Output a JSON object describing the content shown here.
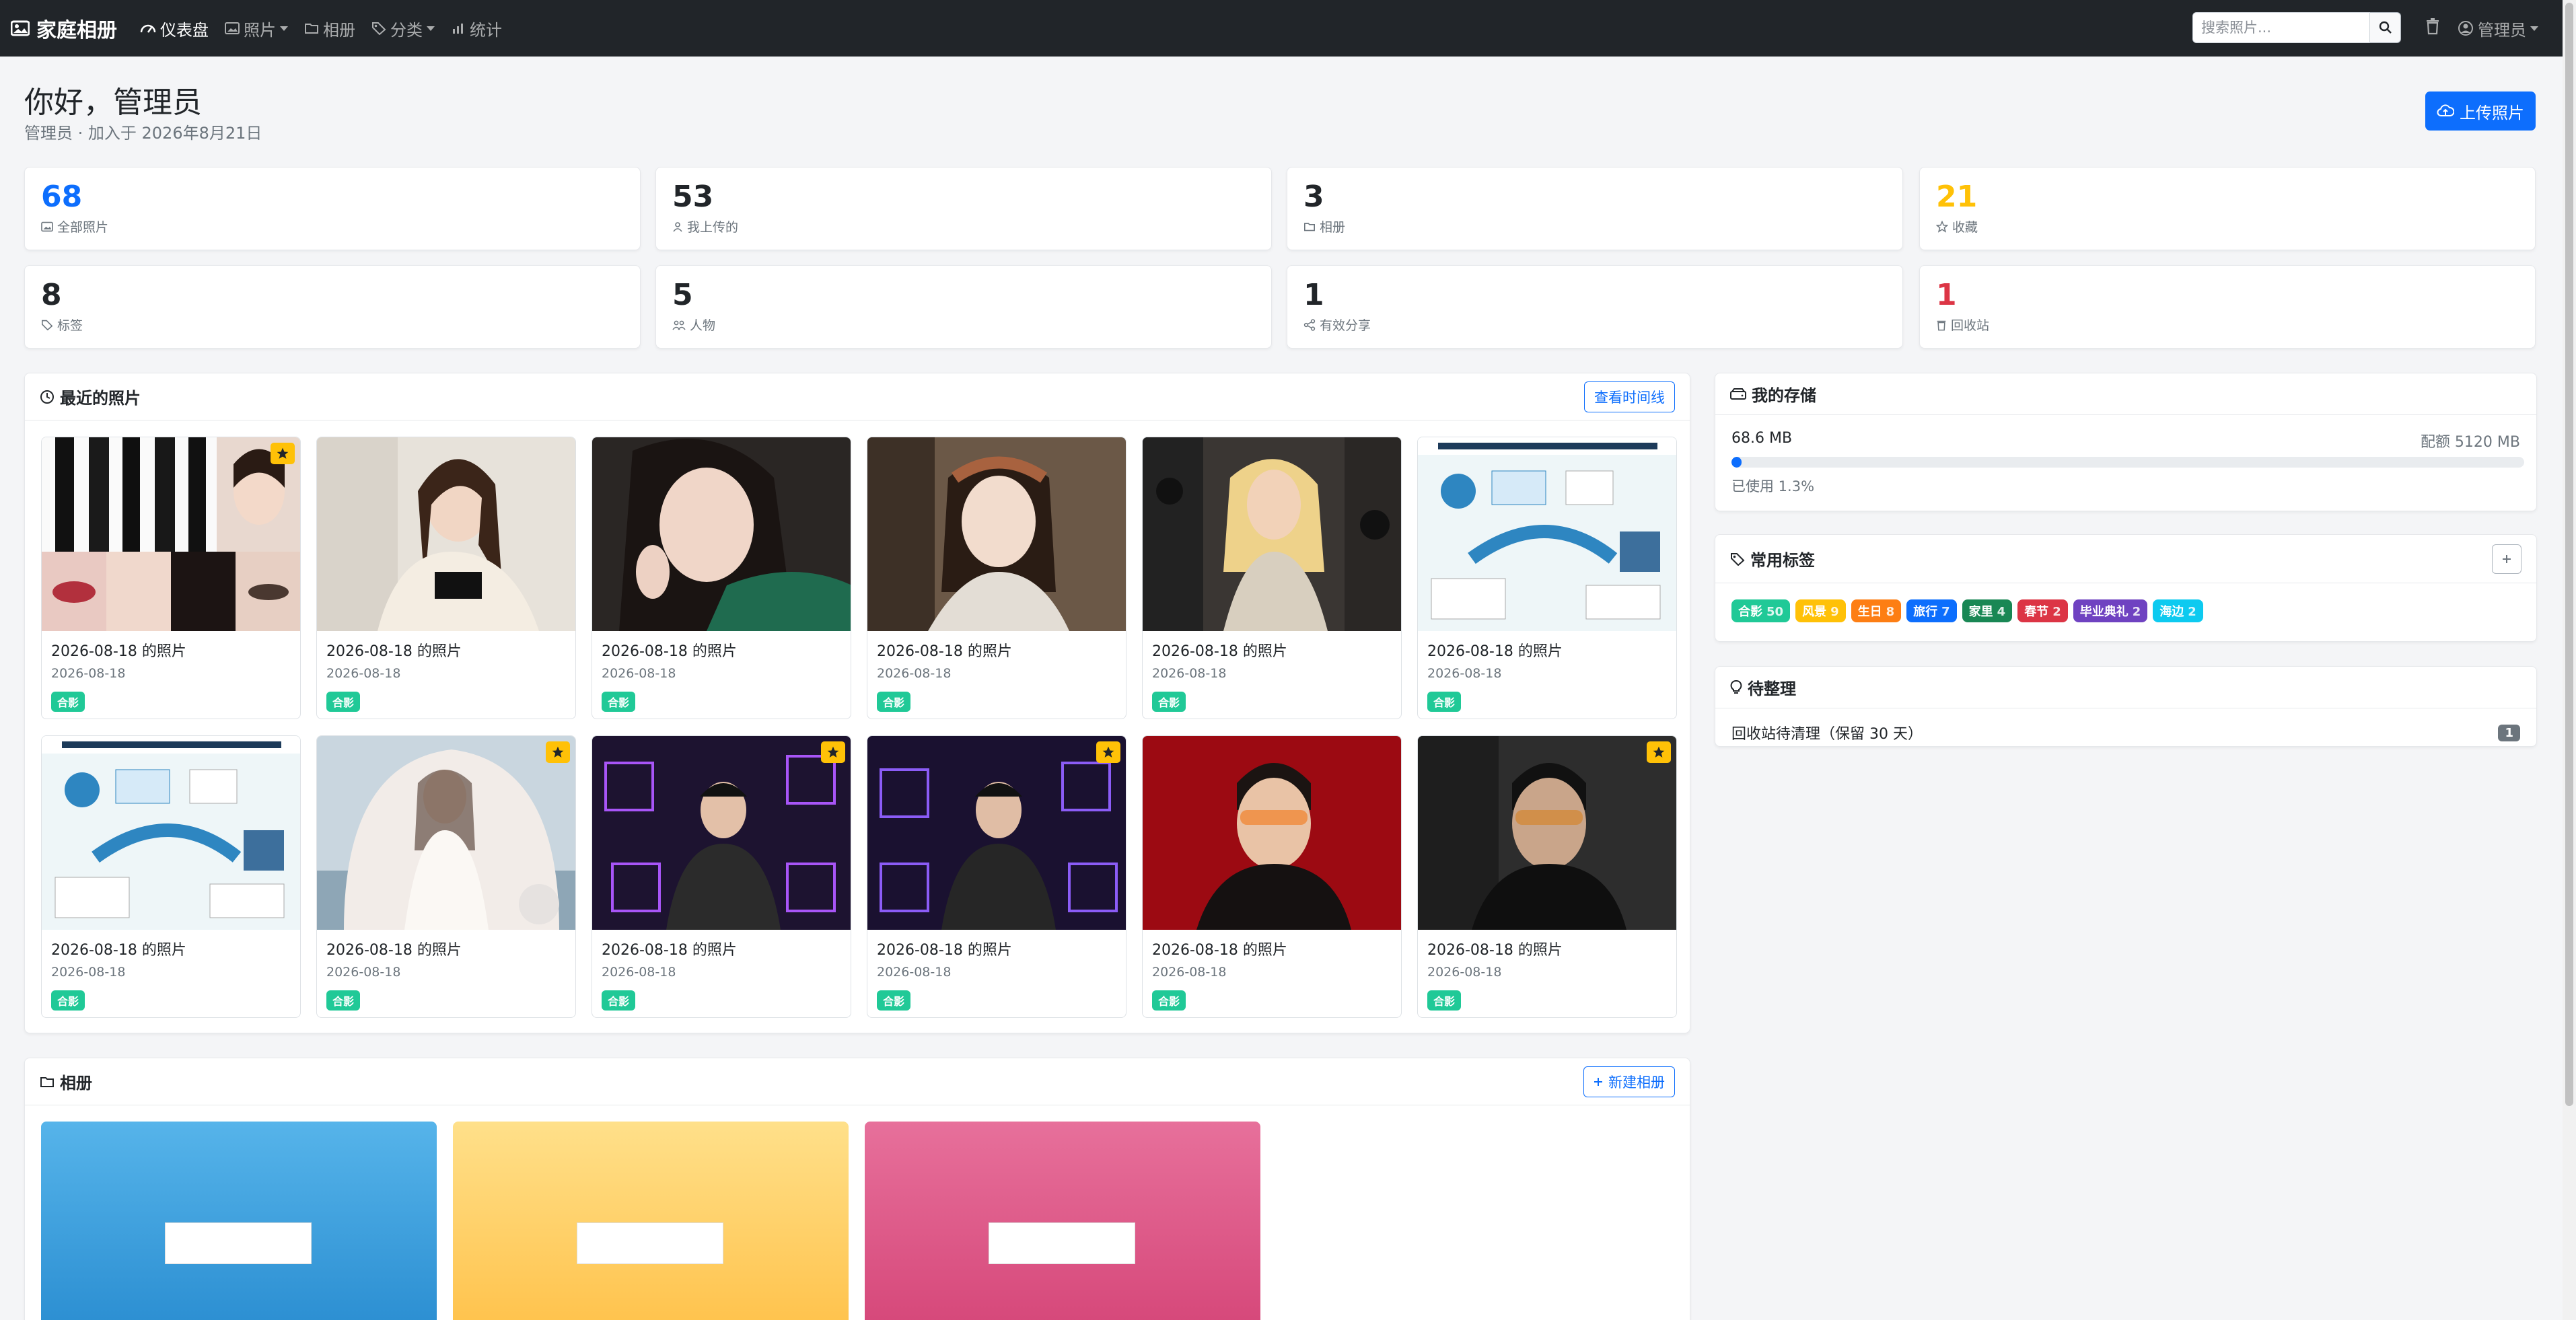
{
  "nav": {
    "brand": "家庭相册",
    "items": [
      {
        "label": "仪表盘",
        "icon": "dashboard-icon",
        "active": true,
        "dropdown": false
      },
      {
        "label": "照片",
        "icon": "image-icon",
        "active": false,
        "dropdown": true
      },
      {
        "label": "相册",
        "icon": "folder-icon",
        "active": false,
        "dropdown": false
      },
      {
        "label": "分类",
        "icon": "tag-icon",
        "active": false,
        "dropdown": true
      },
      {
        "label": "统计",
        "icon": "bar-chart-icon",
        "active": false,
        "dropdown": false
      }
    ],
    "search_placeholder": "搜索照片...",
    "user": "管理员"
  },
  "header": {
    "greeting": "你好，管理员",
    "subtitle": "管理员 · 加入于 2026年8月21日",
    "upload_label": "上传照片"
  },
  "stats": [
    {
      "value": "68",
      "label": "全部照片",
      "color": "#0d6efd",
      "icon": "image-icon"
    },
    {
      "value": "53",
      "label": "我上传的",
      "color": "#212529",
      "icon": "person-icon"
    },
    {
      "value": "3",
      "label": "相册",
      "color": "#212529",
      "icon": "folder-icon"
    },
    {
      "value": "21",
      "label": "收藏",
      "color": "#ffc107",
      "icon": "star-icon"
    },
    {
      "value": "8",
      "label": "标签",
      "color": "#212529",
      "icon": "tag-icon"
    },
    {
      "value": "5",
      "label": "人物",
      "color": "#212529",
      "icon": "people-icon"
    },
    {
      "value": "1",
      "label": "有效分享",
      "color": "#212529",
      "icon": "share-icon"
    },
    {
      "value": "1",
      "label": "回收站",
      "color": "#dc3545",
      "icon": "trash-icon"
    }
  ],
  "recent": {
    "title": "最近的照片",
    "timeline_label": "查看时间线",
    "photos": [
      {
        "title": "2026-08-18 的照片",
        "date": "2026-08-18",
        "tag": "合影",
        "fav": true
      },
      {
        "title": "2026-08-18 的照片",
        "date": "2026-08-18",
        "tag": "合影",
        "fav": false
      },
      {
        "title": "2026-08-18 的照片",
        "date": "2026-08-18",
        "tag": "合影",
        "fav": false
      },
      {
        "title": "2026-08-18 的照片",
        "date": "2026-08-18",
        "tag": "合影",
        "fav": false
      },
      {
        "title": "2026-08-18 的照片",
        "date": "2026-08-18",
        "tag": "合影",
        "fav": false
      },
      {
        "title": "2026-08-18 的照片",
        "date": "2026-08-18",
        "tag": "合影",
        "fav": false
      },
      {
        "title": "2026-08-18 的照片",
        "date": "2026-08-18",
        "tag": "合影",
        "fav": false
      },
      {
        "title": "2026-08-18 的照片",
        "date": "2026-08-18",
        "tag": "合影",
        "fav": true
      },
      {
        "title": "2026-08-18 的照片",
        "date": "2026-08-18",
        "tag": "合影",
        "fav": true
      },
      {
        "title": "2026-08-18 的照片",
        "date": "2026-08-18",
        "tag": "合影",
        "fav": true
      },
      {
        "title": "2026-08-18 的照片",
        "date": "2026-08-18",
        "tag": "合影",
        "fav": false
      },
      {
        "title": "2026-08-18 的照片",
        "date": "2026-08-18",
        "tag": "合影",
        "fav": true
      }
    ]
  },
  "albums": {
    "title": "相册",
    "new_label": "新建相册"
  },
  "storage": {
    "title": "我的存储",
    "used": "68.6 MB",
    "quota": "配额 5120 MB",
    "percent_text": "已使用 1.3%",
    "fraction": 0.013
  },
  "tags": {
    "title": "常用标签",
    "items": [
      {
        "name": "合影",
        "count": "50",
        "color": "#20c997"
      },
      {
        "name": "风景",
        "count": "9",
        "color": "#ffc107"
      },
      {
        "name": "生日",
        "count": "8",
        "color": "#fd7e14"
      },
      {
        "name": "旅行",
        "count": "7",
        "color": "#0d6efd"
      },
      {
        "name": "家里",
        "count": "4",
        "color": "#198754"
      },
      {
        "name": "春节",
        "count": "2",
        "color": "#dc3545"
      },
      {
        "name": "毕业典礼",
        "count": "2",
        "color": "#6f42c1"
      },
      {
        "name": "海边",
        "count": "2",
        "color": "#0dcaf0"
      }
    ]
  },
  "todo": {
    "title": "待整理",
    "items": [
      {
        "label": "回收站待清理（保留 30 天）",
        "count": "1"
      }
    ]
  }
}
